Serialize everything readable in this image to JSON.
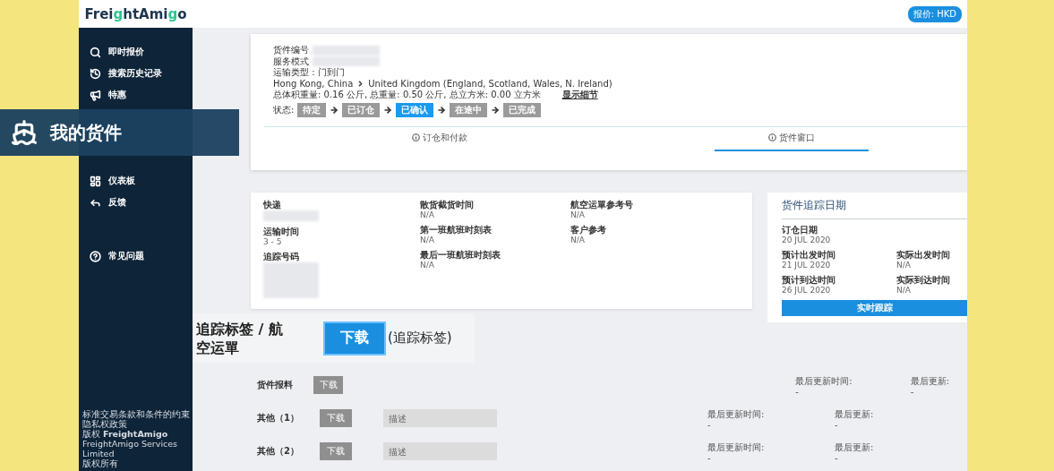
{
  "logo": [
    {
      "text": "Frei",
      "accent": false
    },
    {
      "text": "g",
      "accent": true
    },
    {
      "text": "htAmi",
      "accent": false
    },
    {
      "text": "g",
      "accent": true
    },
    {
      "text": "o",
      "accent": false
    }
  ],
  "currency": "报价: HKD",
  "sidebar": {
    "items": [
      {
        "label": "即时报价"
      },
      {
        "label": "搜索历史记录"
      },
      {
        "label": "特惠"
      },
      {
        "label": "仪表板"
      },
      {
        "label": "反馈"
      },
      {
        "label": "常见问题"
      }
    ],
    "footer": [
      "标准交易条款和条件的约束",
      "隐私权政策",
      "版权 **FreightAmigo** FreightAmigo Services Limited",
      "版权所有"
    ]
  },
  "banner": {
    "title": "我的货件"
  },
  "shipment": {
    "fields": [
      {
        "label": "货件编号",
        "redacted": true
      },
      {
        "label": "服务模式",
        "redacted": true
      },
      {
        "label": "运输类型 : 门到门"
      }
    ],
    "origin": "Hong Kong, China",
    "destination": "United Kingdom (England, Scotland, Wales, N. Ireland)",
    "weights": "总体积重量: 0.16 公斤, 总重量: 0.50 公斤, 总立方米: 0.00 立方米",
    "details_link": "显示细节",
    "status_label": "状态:",
    "steps": [
      {
        "label": "待定",
        "selected": false
      },
      {
        "label": "已订仓",
        "selected": false
      },
      {
        "label": "已确认",
        "selected": true
      },
      {
        "label": "在途中",
        "selected": false
      },
      {
        "label": "已完成",
        "selected": false
      }
    ]
  },
  "tabs": [
    {
      "label": "订仓和付款",
      "selected": false
    },
    {
      "label": "货件窗口",
      "selected": true
    }
  ],
  "details": {
    "columns": [
      [
        {
          "label": "快递",
          "redacted": true
        },
        {
          "label": "运输时间",
          "value": "3 - 5"
        },
        {
          "label": "追踪号码",
          "redacted": true
        }
      ],
      [
        {
          "label": "散货截货时间",
          "value": "N/A"
        },
        {
          "label": "第一班航班时刻表",
          "value": "N/A"
        },
        {
          "label": "最后一班航班时刻表",
          "value": "N/A"
        }
      ],
      [
        {
          "label": "航空运單参考号",
          "value": "N/A"
        },
        {
          "label": "客户参考",
          "value": "N/A"
        }
      ]
    ]
  },
  "tracking_dates": {
    "title": "货件追踪日期",
    "rows": [
      [
        {
          "label": "订仓日期",
          "value": "20 JUL 2020"
        }
      ],
      [
        {
          "label": "预计出发时间",
          "value": "21 JUL 2020"
        },
        {
          "label": "实际出发时间",
          "value": "N/A"
        }
      ],
      [
        {
          "label": "预计到达时间",
          "value": "26 JUL 2020"
        },
        {
          "label": "实际到达时间",
          "value": "N/A"
        }
      ]
    ],
    "button": "实时跟踪"
  },
  "labels_section": {
    "title": "追踪标签 / 航空运單",
    "button": "下载",
    "note": "(追踪标签)"
  },
  "documents": [
    {
      "label": "货件报料",
      "button": "下载",
      "disabled": true,
      "updated_time_label": "最后更新时间:",
      "updated_time": "-",
      "updated_by_label": "最后更新:",
      "updated_by": "-"
    },
    {
      "label": "其他（1）",
      "button": "下载",
      "disabled": true,
      "placeholder": "描述",
      "updated_time_label": "最后更新时间:",
      "updated_time": "-",
      "updated_by_label": "最后更新:",
      "updated_by": "-"
    },
    {
      "label": "其他（2）",
      "button": "下载",
      "disabled": true,
      "placeholder": "描述",
      "updated_time_label": "最后更新时间:",
      "updated_time": "-",
      "updated_by_label": "最后更新:",
      "updated_by": "-"
    }
  ]
}
